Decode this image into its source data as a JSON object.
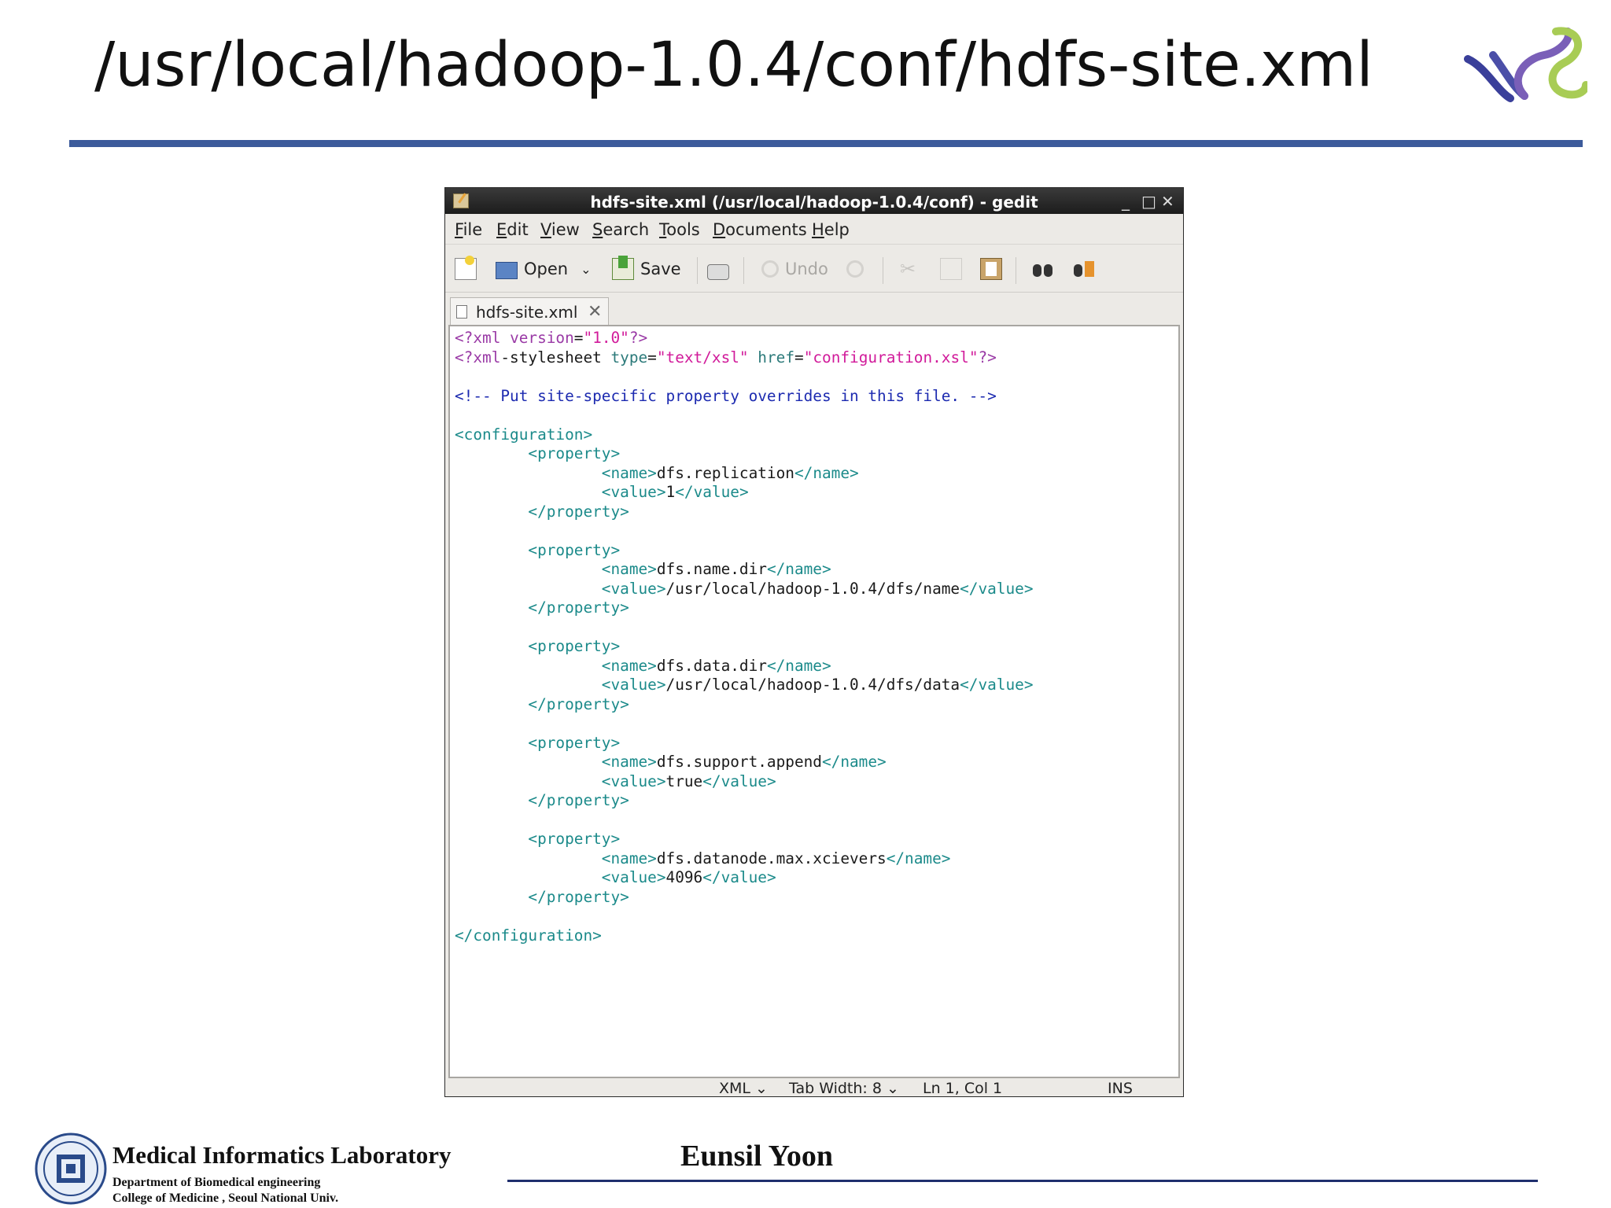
{
  "slide": {
    "title": "/usr/local/hadoop-1.0.4/conf/hdfs-site.xml",
    "colors": {
      "rule": "#3c5b9b",
      "footer_rule": "#1f2f6e"
    }
  },
  "window": {
    "title": "hdfs-site.xml (/usr/local/hadoop-1.0.4/conf) - gedit",
    "controls": [
      "_",
      "□",
      "✕"
    ]
  },
  "menu": [
    "File",
    "Edit",
    "View",
    "Search",
    "Tools",
    "Documents",
    "Help"
  ],
  "toolbar": {
    "open_label": "Open",
    "save_label": "Save",
    "undo_label": "Undo"
  },
  "tab": {
    "label": "hdfs-site.xml",
    "close": "✕"
  },
  "editor": {
    "lines": [
      "<?xml version=\"1.0\"?>",
      "<?xml-stylesheet type=\"text/xsl\" href=\"configuration.xsl\"?>",
      "",
      "<!-- Put site-specific property overrides in this file. -->",
      "",
      "<configuration>",
      "        <property>",
      "                <name>dfs.replication</name>",
      "                <value>1</value>",
      "        </property>",
      "",
      "        <property>",
      "                <name>dfs.name.dir</name>",
      "                <value>/usr/local/hadoop-1.0.4/dfs/name</value>",
      "        </property>",
      "",
      "        <property>",
      "                <name>dfs.data.dir</name>",
      "                <value>/usr/local/hadoop-1.0.4/dfs/data</value>",
      "        </property>",
      "",
      "        <property>",
      "                <name>dfs.support.append</name>",
      "                <value>true</value>",
      "        </property>",
      "",
      "        <property>",
      "                <name>dfs.datanode.max.xcievers</name>",
      "                <value>4096</value>",
      "        </property>",
      "",
      "</configuration>"
    ]
  },
  "status": {
    "language": "XML",
    "tab_width": "Tab Width:  8",
    "position": "Ln 1, Col 1",
    "mode": "INS"
  },
  "footer": {
    "lab_name": "Medical  Informatics Laboratory",
    "department": "Department of Biomedical engineering",
    "college": "College of Medicine , Seoul  National  Univ.",
    "author": "Eunsil Yoon"
  }
}
